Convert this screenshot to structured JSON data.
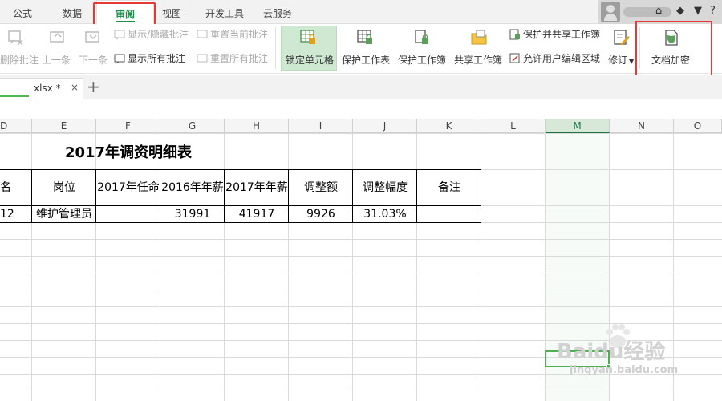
{
  "menu": {
    "tabs": [
      {
        "label": "公式"
      },
      {
        "label": "数据"
      },
      {
        "label": "审阅"
      },
      {
        "label": "视图"
      },
      {
        "label": "开发工具"
      },
      {
        "label": "云服务"
      }
    ],
    "active_tab": "审阅"
  },
  "ribbon": {
    "delete_comment": "删除批注",
    "prev": "上一条",
    "next": "下一条",
    "show_hide_comment": "显示/隐藏批注",
    "show_all_comments": "显示所有批注",
    "reset_current_comment": "重置当前批注",
    "reset_all_comments": "重置所有批注",
    "lock_cells": "锁定单元格",
    "protect_sheet": "保护工作表",
    "protect_workbook": "保护工作簿",
    "share_workbook": "共享工作簿",
    "protect_and_share": "保护并共享工作簿",
    "allow_edit_ranges": "允许用户编辑区域",
    "track_changes": "修订",
    "encrypt_doc": "文档加密"
  },
  "document_tab": {
    "filename": "xlsx *",
    "close": "×",
    "add": "+"
  },
  "columns": [
    "D",
    "E",
    "F",
    "G",
    "H",
    "I",
    "J",
    "K",
    "L",
    "M",
    "N",
    "O"
  ],
  "selected_column": "M",
  "sheet": {
    "title": "2017年调资明细表",
    "headers": [
      "名",
      "岗位",
      "2017年任命",
      "2016年年薪",
      "2017年年薪",
      "调整额",
      "调整幅度",
      "备注"
    ],
    "row": [
      "12",
      "维护管理员",
      "",
      "31991",
      "41917",
      "9926",
      "31.03%",
      ""
    ]
  },
  "watermark": {
    "brand": "Baidu经验",
    "url": "jingyan.baidu.com"
  },
  "colors": {
    "accent_green": "#1f8f4a",
    "highlight_red": "#e53935"
  }
}
